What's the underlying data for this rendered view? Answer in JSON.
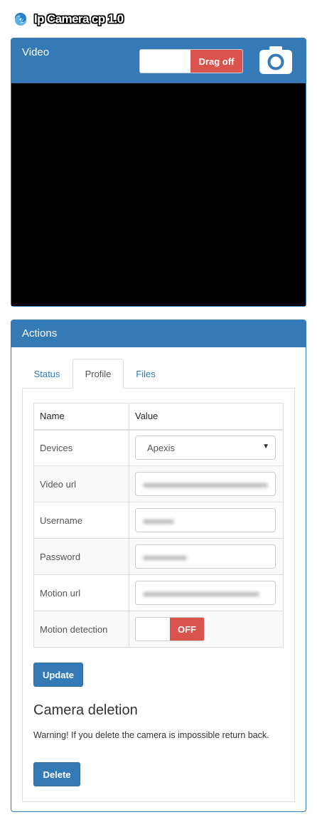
{
  "app": {
    "title": "Ip Camera cp 1.0",
    "logo_icon": "swirl-logo-icon"
  },
  "video_panel": {
    "title": "Video",
    "drag_toggle_label": "Drag off",
    "camera_icon": "camera-icon"
  },
  "actions_panel": {
    "title": "Actions",
    "tabs": [
      {
        "label": "Status",
        "active": false
      },
      {
        "label": "Profile",
        "active": true
      },
      {
        "label": "Files",
        "active": false
      }
    ],
    "table": {
      "headers": [
        "Name",
        "Value"
      ],
      "rows": [
        {
          "label": "Devices",
          "value": "Apexis",
          "type": "select"
        },
        {
          "label": "Video url",
          "value": "",
          "type": "input-blurred"
        },
        {
          "label": "Username",
          "value": "",
          "type": "input-blurred"
        },
        {
          "label": "Password",
          "value": "",
          "type": "input-blurred"
        },
        {
          "label": "Motion url",
          "value": "",
          "type": "input-blurred"
        },
        {
          "label": "Motion detection",
          "value": "OFF",
          "type": "toggle"
        }
      ]
    },
    "update_button": "Update",
    "deletion": {
      "heading": "Camera deletion",
      "warning": "Warning! If you delete the camera is impossible return back.",
      "delete_button": "Delete"
    }
  },
  "colors": {
    "primary": "#337ab7",
    "danger": "#d9534f",
    "video_background": "#000000"
  }
}
